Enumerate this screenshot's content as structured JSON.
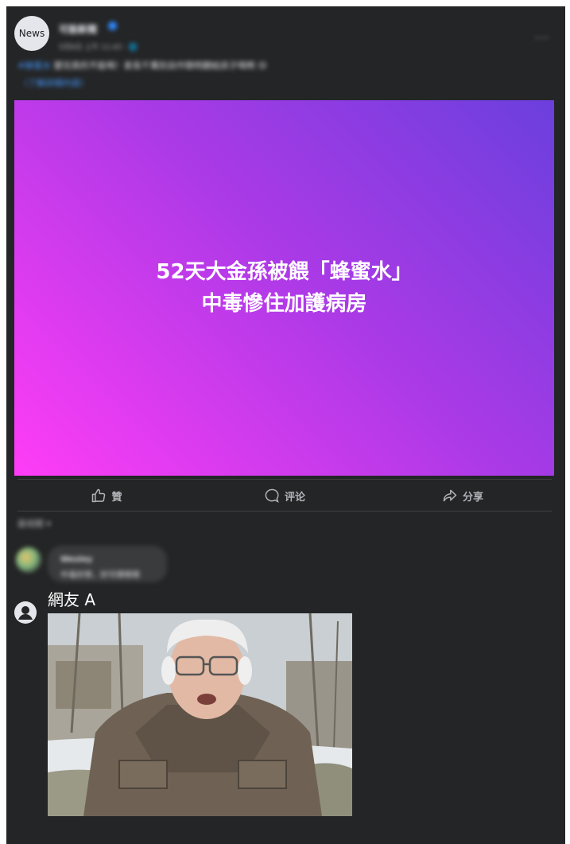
{
  "post": {
    "avatar_label": "News",
    "page_name": "可能新聞",
    "post_time": "5月6日 上午 11:43 · 🌐",
    "more_icon": "more-horizontal-icon",
    "caption_tag": "#蜂蜜水",
    "caption_text": " 嬰兒真的不能喝！家長千萬別自作聰明餵給孩子喝啊 😢",
    "caption_link": "（了解詳細內容）"
  },
  "banner": {
    "line1": "52天大金孫被餵「蜂蜜水」",
    "line2": "中毒慘住加護病房",
    "gradient_start": "#ff3cf6",
    "gradient_end": "#6b3fdd"
  },
  "actions": {
    "like_label": "贊",
    "comment_label": "评论",
    "share_label": "分享"
  },
  "comments": {
    "sort_label": "最相關 ▾",
    "first": {
      "name": "Wesley",
      "text": "中毒好慘，好可憐嗯嗯"
    },
    "second": {
      "name": "網友 A",
      "image_icon": "elderly-man-in-parka-meme-photo"
    }
  },
  "colors": {
    "background": "#242526",
    "text_primary": "#e4e6eb",
    "text_secondary": "#b0b3b8",
    "link": "#4599ff"
  }
}
